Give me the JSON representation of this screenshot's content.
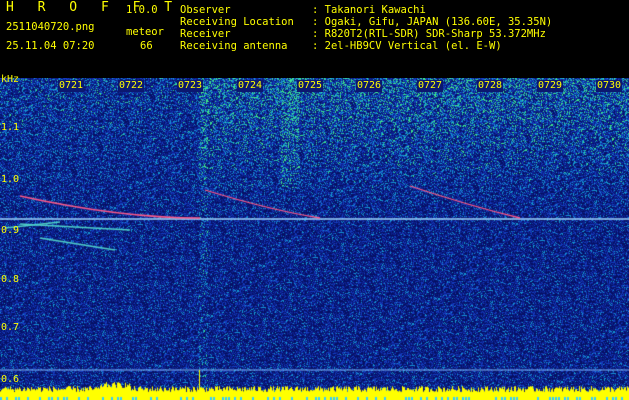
{
  "header": {
    "app_title": "H R O F F T",
    "app_version": "1.0.0",
    "file_name": "2511040720.png",
    "timestamp": "25.11.04 07:20",
    "meteor_label": "meteor",
    "meteor_count": "66"
  },
  "info": [
    {
      "key": "Observer",
      "value": ": Takanori Kawachi"
    },
    {
      "key": "Receiving Location",
      "value": ": Ogaki, Gifu, JAPAN (136.60E, 35.35N)"
    },
    {
      "key": "Receiver",
      "value": ": R820T2(RTL-SDR) SDR-Sharp 53.372MHz"
    },
    {
      "key": "Receiving antenna",
      "value": ": 2el-HB9CV Vertical (el. E-W)"
    }
  ],
  "time_axis": {
    "ticks": [
      "0721",
      "0722",
      "0723",
      "0724",
      "0725",
      "0726",
      "0727",
      "0728",
      "0729",
      "0730"
    ]
  },
  "freq_axis": {
    "unit": "kHz",
    "ticks": [
      "1.1",
      "1.0",
      "0.9",
      "0.8",
      "0.7",
      "0.6"
    ]
  },
  "colors": {
    "label": "#ffff00",
    "background_noise": "#0b1a7a",
    "carrier": "#9fd6ff",
    "meteor_trace": "#ff5a8a",
    "power_bar": "#ffff00"
  }
}
